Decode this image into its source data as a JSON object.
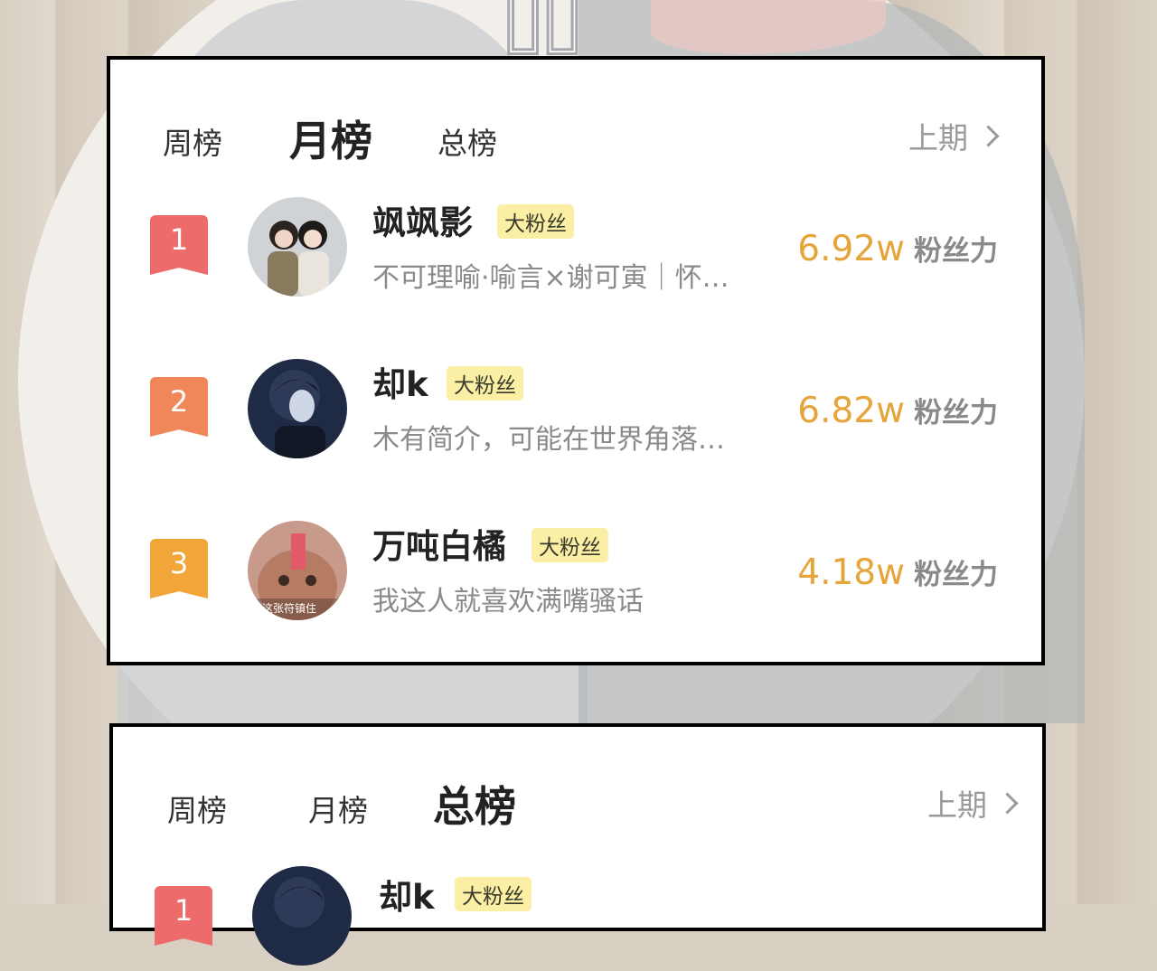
{
  "colors": {
    "rank1": "#ee6b6b",
    "rank2": "#f0875a",
    "rank3": "#f2a63a",
    "score": "#e6a53a",
    "badge_bg": "#fbefa6"
  },
  "monthly_board": {
    "tabs": [
      {
        "label": "周榜",
        "active": false
      },
      {
        "label": "月榜",
        "active": true
      },
      {
        "label": "总榜",
        "active": false
      }
    ],
    "prev_label": "上期",
    "rows": [
      {
        "rank": "1",
        "name": "飒飒影",
        "badge": "大粉丝",
        "desc": "不可理喻·喻言×谢可寅｜怀…",
        "score": "6.92w",
        "score_unit": "粉丝力"
      },
      {
        "rank": "2",
        "name": "却k",
        "badge": "大粉丝",
        "desc": "木有简介，可能在世界角落…",
        "score": "6.82w",
        "score_unit": "粉丝力"
      },
      {
        "rank": "3",
        "name": "万吨白橘",
        "badge": "大粉丝",
        "desc": "我这人就喜欢满嘴骚话",
        "score": "4.18w",
        "score_unit": "粉丝力"
      }
    ]
  },
  "total_board": {
    "tabs": [
      {
        "label": "周榜",
        "active": false
      },
      {
        "label": "月榜",
        "active": false
      },
      {
        "label": "总榜",
        "active": true
      }
    ],
    "prev_label": "上期",
    "rows": [
      {
        "rank": "1",
        "name": "却k",
        "badge": "大粉丝"
      }
    ]
  },
  "avatar_caption": "用这张符镇住"
}
